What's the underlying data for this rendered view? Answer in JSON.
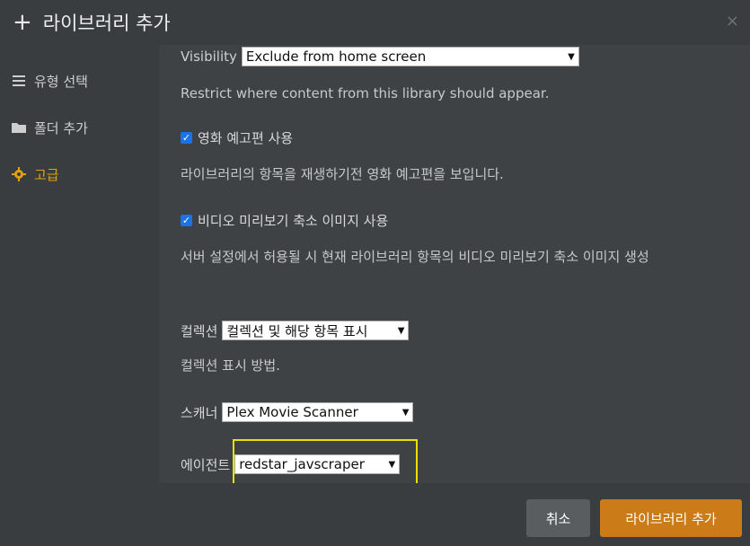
{
  "header": {
    "title": "라이브러리 추가",
    "close": "×"
  },
  "sidebar": {
    "items": [
      {
        "label": "유형 선택"
      },
      {
        "label": "폴더 추가"
      },
      {
        "label": "고급"
      }
    ]
  },
  "content": {
    "visibility_label": "Visibility",
    "visibility_value": "Exclude from home screen",
    "visibility_desc": "Restrict where content from this library should appear.",
    "trailers_label": "영화 예고편 사용",
    "trailers_checked": true,
    "trailers_desc": "라이브러리의 항목을 재생하기전 영화 예고편을 보입니다.",
    "thumbs_label": "비디오 미리보기 축소 이미지 사용",
    "thumbs_checked": true,
    "thumbs_desc": "서버 설정에서 허용될 시 현재 라이브러리 항목의 비디오 미리보기 축소 이미지 생성",
    "collections_label": "컬렉션",
    "collections_value": "컬렉션 및 해당 항목 표시",
    "collections_desc": "컬렉션 표시 방법.",
    "scanner_label": "스캐너",
    "scanner_value": "Plex Movie Scanner",
    "agent_label": "에이전트",
    "agent_value": "redstar_javscraper"
  },
  "footer": {
    "cancel_label": "취소",
    "add_label": "라이브러리 추가"
  },
  "colors": {
    "accent": "#e5a00d",
    "add_button": "#cc7b19",
    "highlight": "#f0e000"
  },
  "icons": [
    "plus-icon",
    "close-icon",
    "list-icon",
    "folder-icon",
    "gear-icon",
    "checkbox-icon",
    "chevron-down-icon"
  ]
}
